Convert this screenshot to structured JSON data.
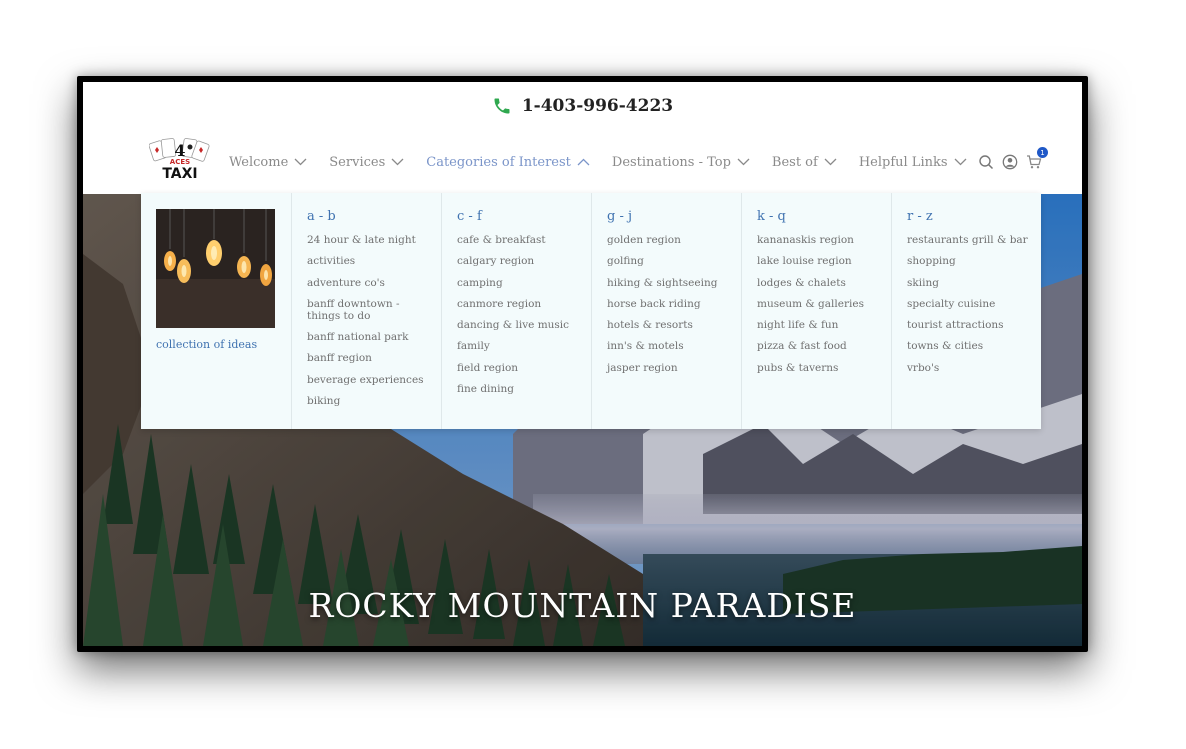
{
  "topbar": {
    "phone": "1-403-996-4223",
    "accent": "#2fa84f"
  },
  "logo": {
    "line1": "4",
    "line2": "ACES",
    "line3": "TAXI"
  },
  "nav": {
    "items": [
      {
        "label": "Welcome",
        "active": false
      },
      {
        "label": "Services",
        "active": false
      },
      {
        "label": "Categories of Interest",
        "active": true
      },
      {
        "label": "Destinations - Top",
        "active": false
      },
      {
        "label": "Best of",
        "active": false
      },
      {
        "label": "Helpful Links",
        "active": false
      }
    ],
    "cart_count": "1",
    "active_color": "#7b95c9"
  },
  "dropdown": {
    "feature_link": "collection of ideas",
    "columns": [
      {
        "heading": "a - b",
        "items": [
          "24 hour & late night",
          "activities",
          "adventure co's",
          "banff downtown - things to do",
          "banff national park",
          "banff region",
          "beverage experiences",
          "biking"
        ]
      },
      {
        "heading": "c - f",
        "items": [
          "cafe & breakfast",
          "calgary region",
          "camping",
          "canmore region",
          "dancing & live music",
          "family",
          "field region",
          "fine dining"
        ]
      },
      {
        "heading": "g - j",
        "items": [
          "golden region",
          "golfing",
          "hiking & sightseeing",
          "horse back riding",
          "hotels & resorts",
          "inn's & motels",
          "jasper region"
        ]
      },
      {
        "heading": "k - q",
        "items": [
          "kananaskis region",
          "lake louise region",
          "lodges & chalets",
          "museum & galleries",
          "night life & fun",
          "pizza & fast food",
          "pubs & taverns"
        ]
      },
      {
        "heading": "r - z",
        "items": [
          "restaurants grill & bar",
          "shopping",
          "skiing",
          "specialty cuisine",
          "tourist attractions",
          "towns & cities",
          "vrbo's"
        ]
      }
    ]
  },
  "hero": {
    "title": "ROCKY MOUNTAIN PARADISE"
  }
}
